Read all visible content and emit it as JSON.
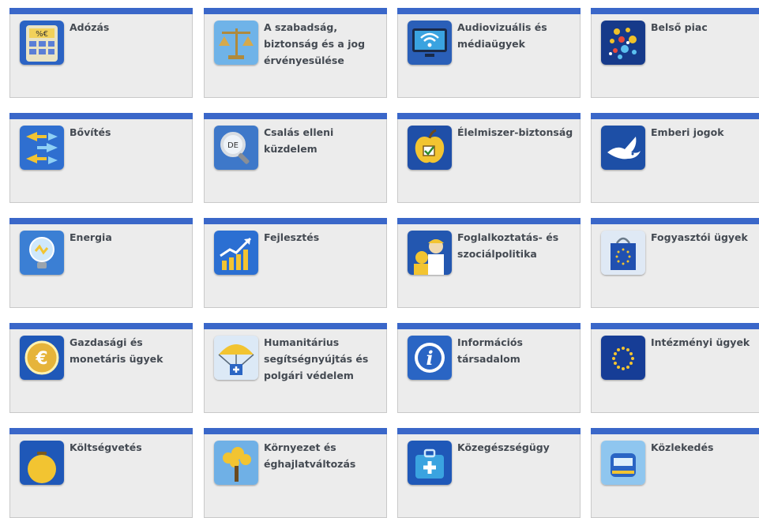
{
  "tiles": [
    {
      "label": "Adózás",
      "icon": "calculator-icon"
    },
    {
      "label": "A szabadság, biztonság és a jog érvényesülése",
      "icon": "scales-icon"
    },
    {
      "label": "Audiovizuális és médiaügyek",
      "icon": "monitor-wifi-icon"
    },
    {
      "label": "Belső piac",
      "icon": "dots-globe-icon"
    },
    {
      "label": "Bővítés",
      "icon": "arrows-icon"
    },
    {
      "label": "Csalás elleni küzdelem",
      "icon": "magnifier-icon"
    },
    {
      "label": "Élelmiszer-biztonság",
      "icon": "apple-checkbox-icon"
    },
    {
      "label": "Emberi jogok",
      "icon": "dove-icon"
    },
    {
      "label": "Energia",
      "icon": "lightbulb-icon"
    },
    {
      "label": "Fejlesztés",
      "icon": "growth-chart-icon"
    },
    {
      "label": "Foglalkoztatás- és szociálpolitika",
      "icon": "workers-icon"
    },
    {
      "label": "Fogyasztói ügyek",
      "icon": "shopping-bag-icon"
    },
    {
      "label": "Gazdasági és monetáris ügyek",
      "icon": "euro-coin-icon"
    },
    {
      "label": "Humanitárius segítségnyújtás és polgári védelem",
      "icon": "parachute-aid-icon"
    },
    {
      "label": "Információs társadalom",
      "icon": "info-icon"
    },
    {
      "label": "Intézményi ügyek",
      "icon": "eu-flag-icon"
    },
    {
      "label": "Költségvetés",
      "icon": "piggy-bank-icon"
    },
    {
      "label": "Környezet és éghajlatváltozás",
      "icon": "tree-icon"
    },
    {
      "label": "Közegészségügy",
      "icon": "medical-kit-icon"
    },
    {
      "label": "Közlekedés",
      "icon": "train-icon"
    }
  ]
}
